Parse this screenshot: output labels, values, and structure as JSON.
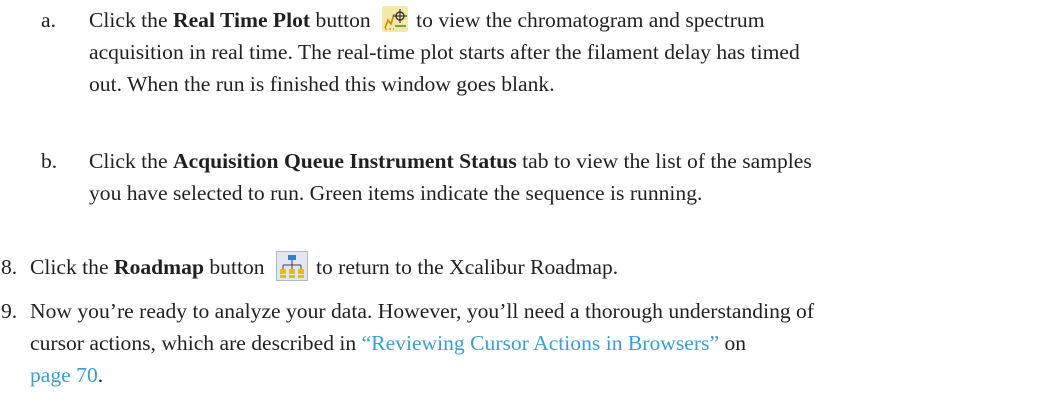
{
  "step_a": {
    "marker": "a.",
    "pre": "Click the ",
    "bold": "Real Time Plot",
    "post1": " button",
    "post2": "to view the chromatogram and spectrum",
    "line2": "acquisition in real time. The real-time plot starts after the filament delay has timed",
    "line3": "out. When the run is finished this window goes blank.",
    "icon": "real-time-plot-icon"
  },
  "step_b": {
    "marker": "b.",
    "pre": "Click the ",
    "bold": "Acquisition Queue Instrument Status",
    "post": " tab to view the list of the samples",
    "line2": "you have selected to run. Green items indicate the sequence is running."
  },
  "step_8": {
    "marker": "8.",
    "pre": "Click the ",
    "bold": "Roadmap",
    "post1": " button",
    "post2": "to return to the Xcalibur Roadmap.",
    "icon": "roadmap-icon"
  },
  "step_9": {
    "marker": "9.",
    "line1": "Now you’re ready to analyze your data. However, you’ll need a thorough understanding of",
    "line2_pre": "cursor actions, which are described in ",
    "link": "“Reviewing Cursor Actions in Browsers”",
    "line2_post": " on",
    "page_link": "page 70",
    "line3_post": "."
  },
  "colors": {
    "text": "#231f20",
    "link": "#3a9fd8"
  }
}
